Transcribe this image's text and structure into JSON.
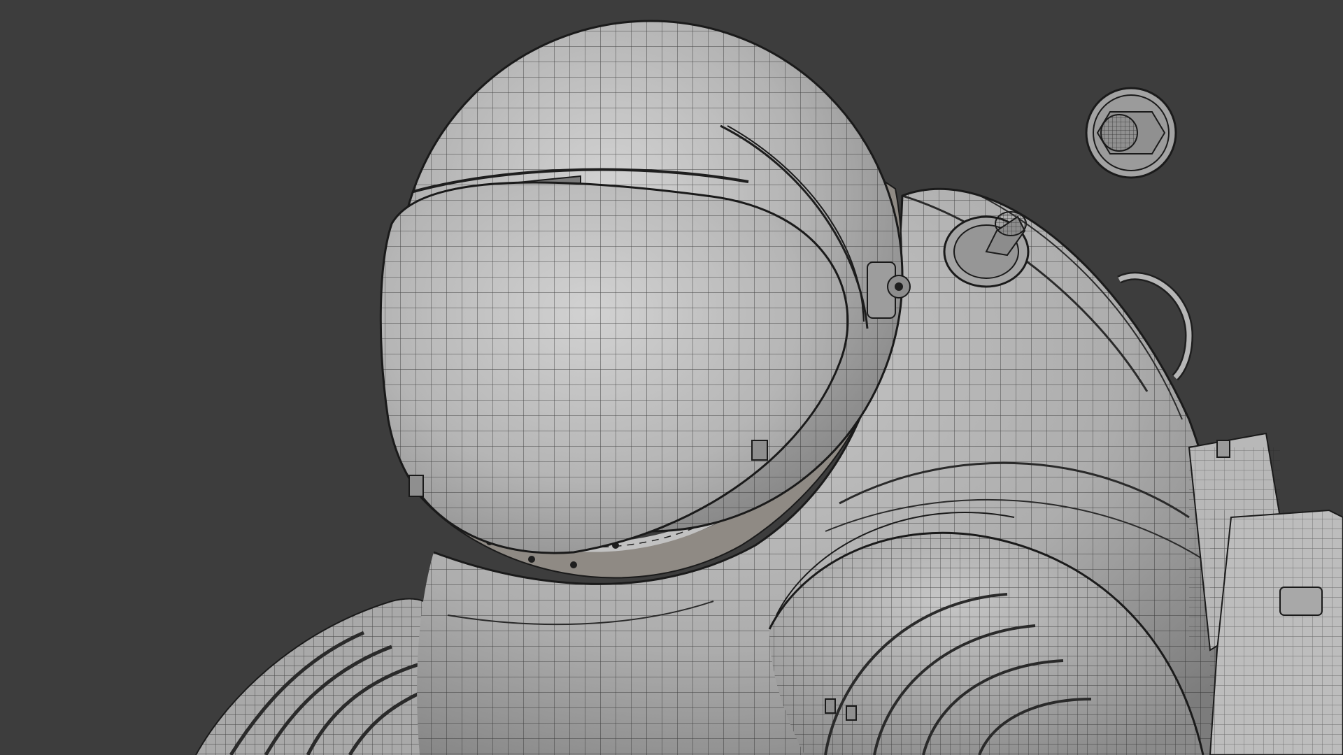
{
  "scene": {
    "kind": "3d-viewport-wireframe",
    "subject": "astronaut-suit",
    "shading": "solid-with-wireframe-overlay"
  },
  "colors": {
    "background": "#3d3d3d",
    "surface_light": "#c9c9c9",
    "surface_mid": "#a8a8a8",
    "surface_dark": "#6e6e6e",
    "wire": "#1e1e1e",
    "rim_brown": "#8a7f72"
  },
  "objects": [
    {
      "name": "helmet-dome",
      "component": "helmet"
    },
    {
      "name": "helmet-visor",
      "component": "visor"
    },
    {
      "name": "neck-ring",
      "component": "collar"
    },
    {
      "name": "torso-upper",
      "component": "torso"
    },
    {
      "name": "shoulder-left",
      "component": "shoulder"
    },
    {
      "name": "arm-right-rings",
      "component": "arm"
    },
    {
      "name": "valve-connector",
      "component": "hose-fitting"
    },
    {
      "name": "floating-fitting",
      "component": "detached-part"
    },
    {
      "name": "handle-loop",
      "component": "handle"
    },
    {
      "name": "backpack-bracket",
      "component": "life-support"
    }
  ]
}
